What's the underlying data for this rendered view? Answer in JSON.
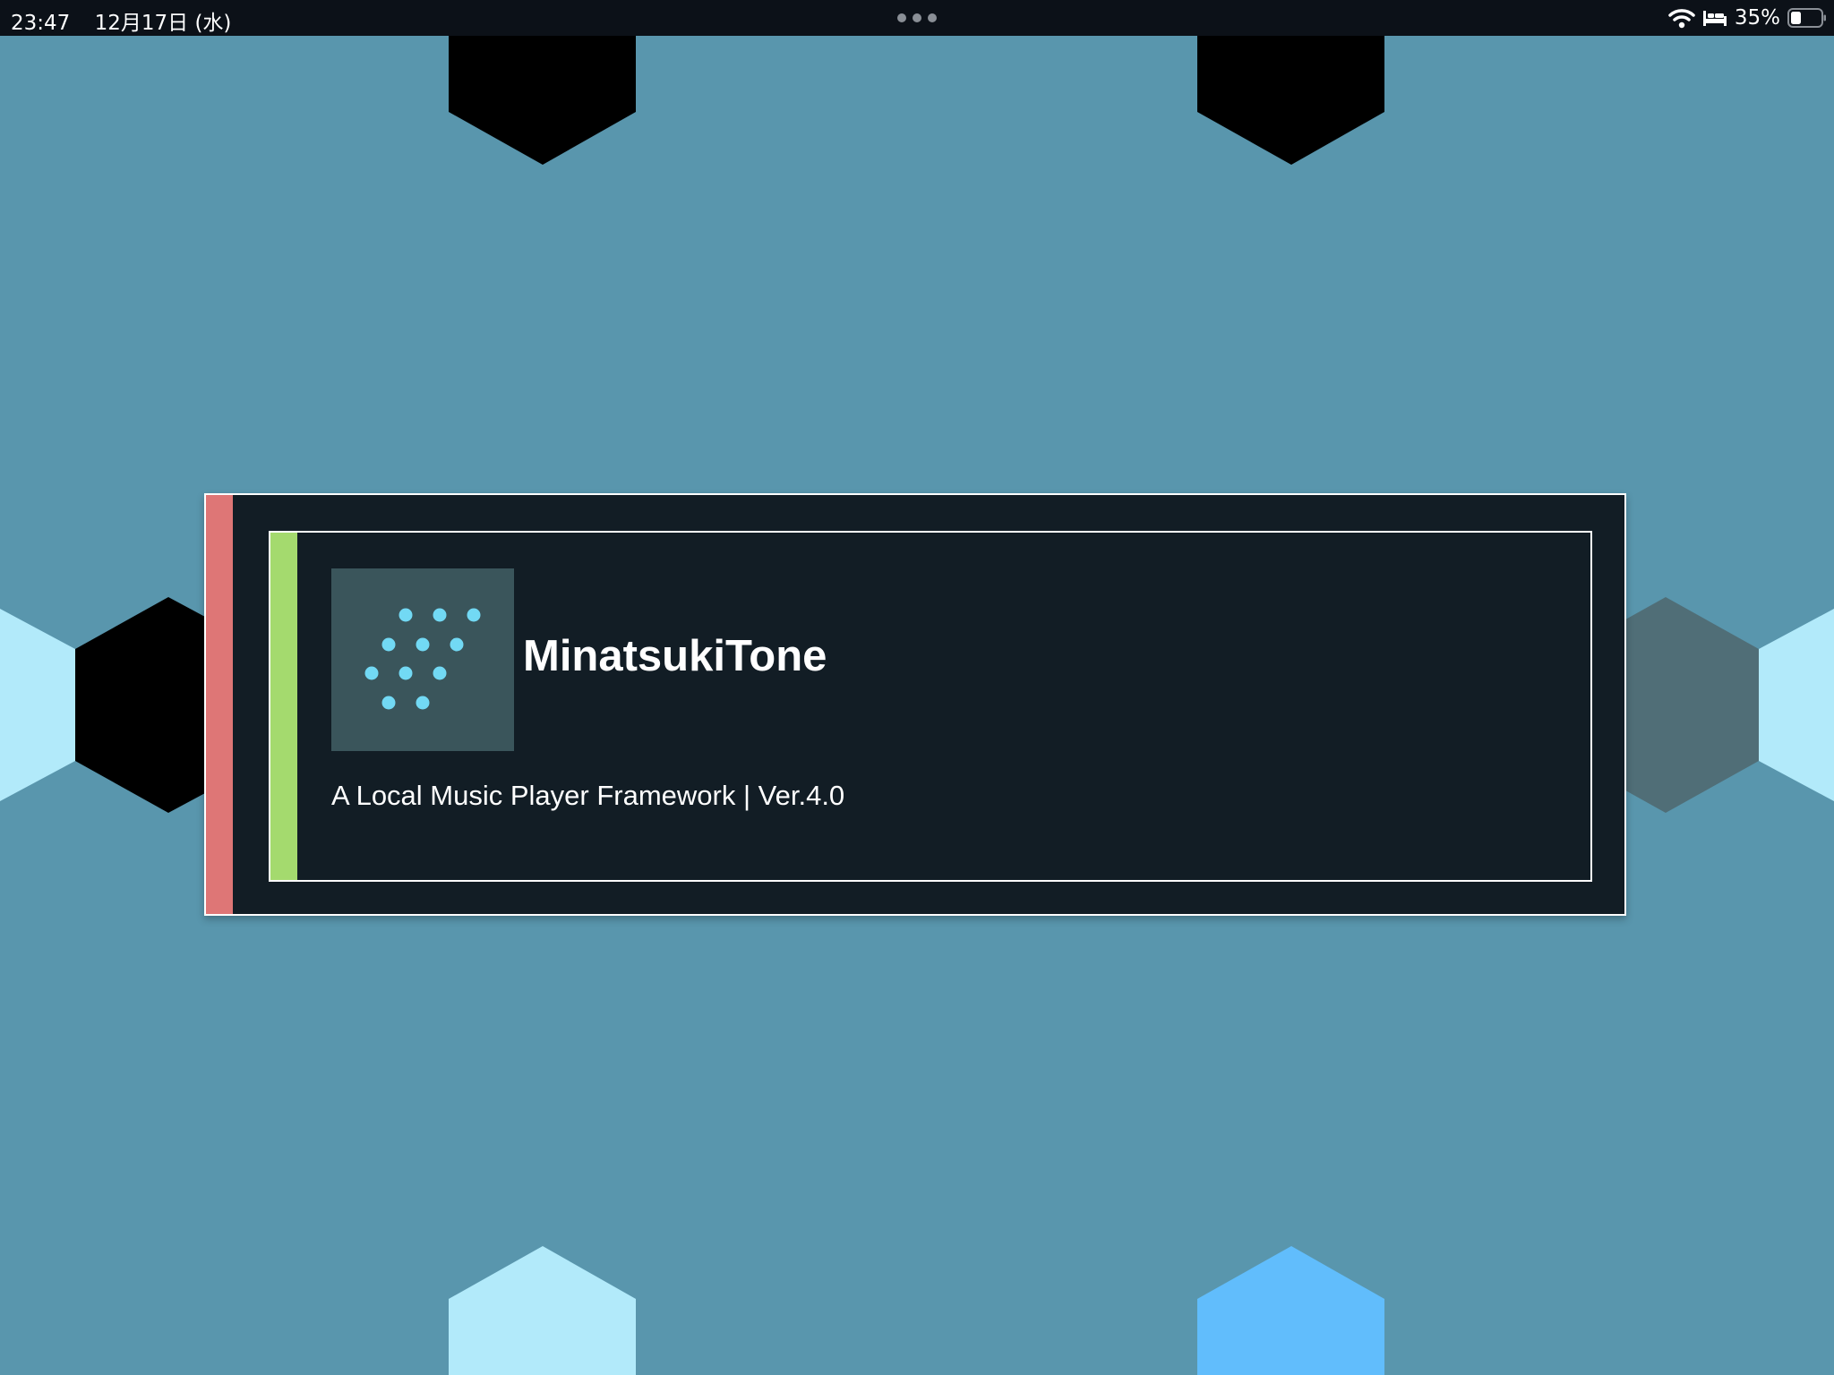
{
  "status_bar": {
    "time": "23:47",
    "date": "12月17日 (水)",
    "battery_percent": "35%",
    "battery_level": 0.35,
    "icons": [
      "more-dots-icon",
      "wifi-icon",
      "sleep-bed-icon",
      "battery-icon"
    ]
  },
  "app": {
    "title": "MinatsukiTone",
    "subtitle": "A Local Music Player Framework | Ver.4.0",
    "icon": "dot-grid-logo-icon"
  },
  "colors": {
    "background": "#5996ad",
    "card": "#121d25",
    "accent_red": "#de7676",
    "accent_green": "#a4da6e",
    "icon_bg": "#3a555b",
    "icon_dots": "#72d9f4",
    "hex_black": "#000000",
    "hex_light_cyan": "#b2eafa",
    "hex_slate": "#506e77",
    "hex_sky_blue": "#61bdfc",
    "status_bar": "#0c1118"
  }
}
